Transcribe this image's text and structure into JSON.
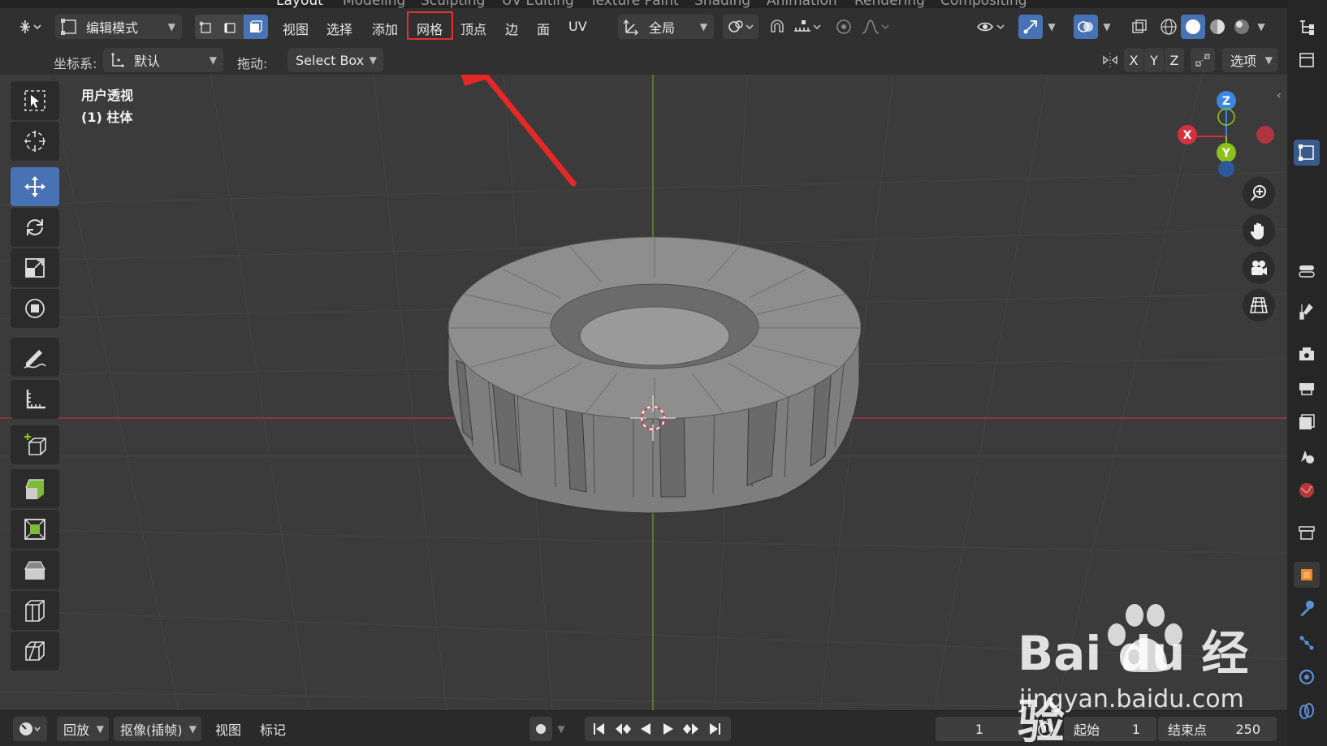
{
  "workspaces": [
    "Layout",
    "Modeling",
    "Sculpting",
    "UV Editing",
    "Texture Paint",
    "Shading",
    "Animation",
    "Rendering",
    "Compositing"
  ],
  "header": {
    "mode": "编辑模式",
    "menus": [
      "视图",
      "选择",
      "添加",
      "网格",
      "顶点",
      "边",
      "面",
      "UV"
    ],
    "highlighted_menu": "网格",
    "transform_orientation": "全局"
  },
  "toolrow": {
    "coord_label": "坐标系:",
    "coord_value": "默认",
    "drag_label": "拖动:",
    "drag_value": "Select Box",
    "axes": [
      "X",
      "Y",
      "Z"
    ],
    "options": "选项"
  },
  "viewport": {
    "view_name": "用户透视",
    "object_name": "(1) 柱体",
    "gizmo": {
      "z": "Z",
      "x": "X",
      "y": "Y"
    }
  },
  "timeline": {
    "playback": "回放",
    "keying": "抠像(插帧)",
    "view": "视图",
    "marker": "标记",
    "current_frame": "1",
    "start_label": "起始",
    "start_value": "1",
    "end_label": "结束点",
    "end_value": "250"
  },
  "watermark": {
    "brand": "Bai du 经验",
    "url": "jingyan.baidu.com"
  },
  "colors": {
    "accent": "#4772b3",
    "highlight": "#e53030",
    "x_axis": "#d4313f",
    "y_axis": "#8cc218",
    "z_axis": "#3b86e0"
  }
}
